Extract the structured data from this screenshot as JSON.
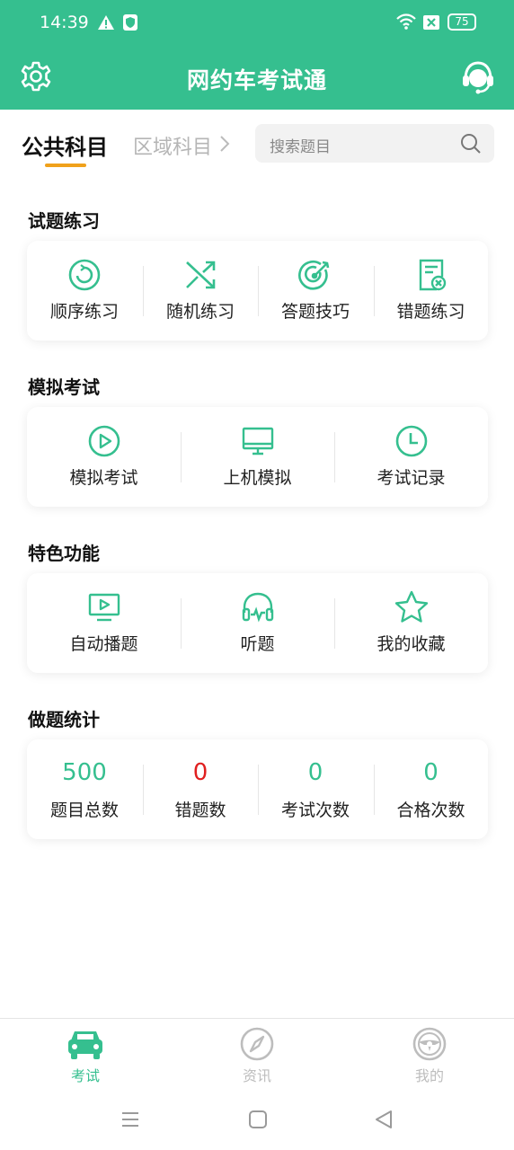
{
  "status_bar": {
    "time": "14:39",
    "battery": "75"
  },
  "app": {
    "title": "网约车考试通"
  },
  "subjects": {
    "active": "公共科目",
    "other": "区域科目"
  },
  "search": {
    "placeholder": "搜索题目"
  },
  "practice": {
    "title": "试题练习",
    "items": [
      {
        "label": "顺序练习",
        "icon": "sequence-icon"
      },
      {
        "label": "随机练习",
        "icon": "shuffle-icon"
      },
      {
        "label": "答题技巧",
        "icon": "target-icon"
      },
      {
        "label": "错题练习",
        "icon": "wrong-doc-icon"
      }
    ]
  },
  "exam": {
    "title": "模拟考试",
    "items": [
      {
        "label": "模拟考试",
        "icon": "play-circle-icon"
      },
      {
        "label": "上机模拟",
        "icon": "monitor-icon"
      },
      {
        "label": "考试记录",
        "icon": "clock-icon"
      }
    ]
  },
  "features": {
    "title": "特色功能",
    "items": [
      {
        "label": "自动播题",
        "icon": "video-play-icon"
      },
      {
        "label": "听题",
        "icon": "headphones-icon"
      },
      {
        "label": "我的收藏",
        "icon": "star-icon"
      }
    ]
  },
  "stats": {
    "title": "做题统计",
    "items": [
      {
        "value": "500",
        "label": "题目总数",
        "color": "#35bf8f"
      },
      {
        "value": "0",
        "label": "错题数",
        "color": "#e02020"
      },
      {
        "value": "0",
        "label": "考试次数",
        "color": "#35bf8f"
      },
      {
        "value": "0",
        "label": "合格次数",
        "color": "#35bf8f"
      }
    ]
  },
  "bottom_nav": [
    {
      "label": "考试",
      "icon": "car-icon",
      "active": true
    },
    {
      "label": "资讯",
      "icon": "compass-icon",
      "active": false
    },
    {
      "label": "我的",
      "icon": "steering-wheel-icon",
      "active": false
    }
  ],
  "colors": {
    "primary": "#35bf8f",
    "accent_underline": "#f0a11b",
    "error": "#e02020",
    "inactive": "#bdbdbd"
  }
}
